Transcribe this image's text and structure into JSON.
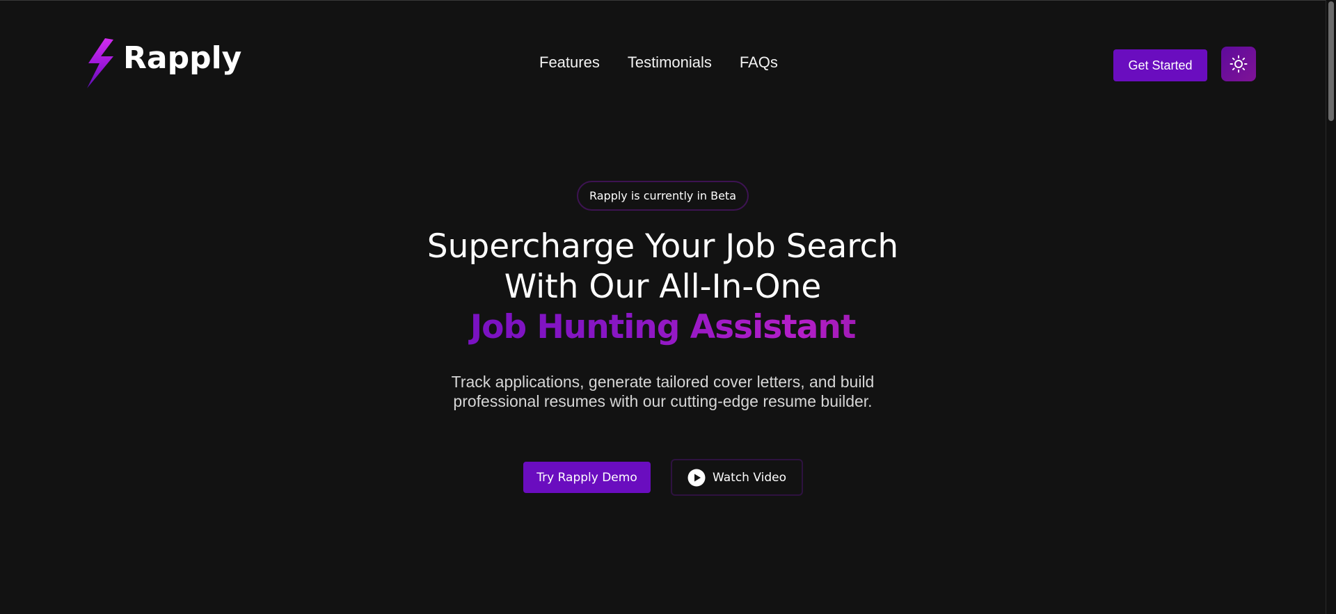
{
  "brand": {
    "name": "Rapply",
    "accent_color": "#6a0dbf",
    "gradient_colors": [
      "#6a0dbf",
      "#b41fc8",
      "#6d0f86"
    ]
  },
  "nav": {
    "items": [
      {
        "label": "Features"
      },
      {
        "label": "Testimonials"
      },
      {
        "label": "FAQs"
      }
    ]
  },
  "header": {
    "cta_label": "Get Started",
    "theme_toggle_icon": "sun-icon"
  },
  "hero": {
    "badge": "Rapply is currently in Beta",
    "headline_line1": "Supercharge Your Job Search",
    "headline_line2": "With Our All-In-One",
    "headline_accent": "Job Hunting Assistant",
    "subtitle_line1": "Track applications, generate tailored cover letters, and build",
    "subtitle_line2": "professional resumes with our cutting-edge resume builder.",
    "primary_button": "Try Rapply Demo",
    "secondary_button": "Watch Video",
    "secondary_icon": "play-icon"
  }
}
